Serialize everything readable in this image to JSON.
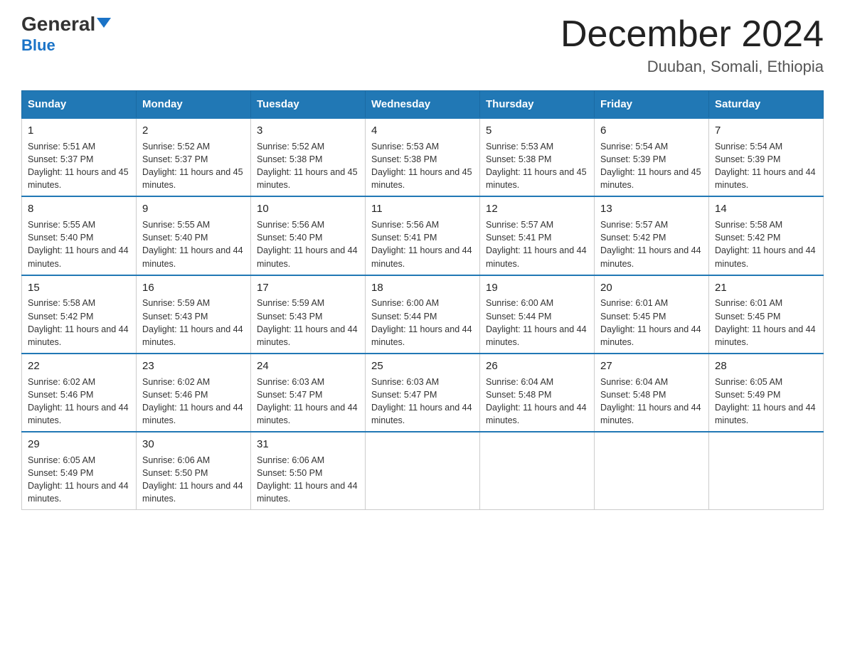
{
  "header": {
    "logo_general": "General",
    "logo_blue": "Blue",
    "title": "December 2024",
    "subtitle": "Duuban, Somali, Ethiopia"
  },
  "weekdays": [
    "Sunday",
    "Monday",
    "Tuesday",
    "Wednesday",
    "Thursday",
    "Friday",
    "Saturday"
  ],
  "weeks": [
    [
      {
        "day": "1",
        "sunrise": "5:51 AM",
        "sunset": "5:37 PM",
        "daylight": "11 hours and 45 minutes."
      },
      {
        "day": "2",
        "sunrise": "5:52 AM",
        "sunset": "5:37 PM",
        "daylight": "11 hours and 45 minutes."
      },
      {
        "day": "3",
        "sunrise": "5:52 AM",
        "sunset": "5:38 PM",
        "daylight": "11 hours and 45 minutes."
      },
      {
        "day": "4",
        "sunrise": "5:53 AM",
        "sunset": "5:38 PM",
        "daylight": "11 hours and 45 minutes."
      },
      {
        "day": "5",
        "sunrise": "5:53 AM",
        "sunset": "5:38 PM",
        "daylight": "11 hours and 45 minutes."
      },
      {
        "day": "6",
        "sunrise": "5:54 AM",
        "sunset": "5:39 PM",
        "daylight": "11 hours and 45 minutes."
      },
      {
        "day": "7",
        "sunrise": "5:54 AM",
        "sunset": "5:39 PM",
        "daylight": "11 hours and 44 minutes."
      }
    ],
    [
      {
        "day": "8",
        "sunrise": "5:55 AM",
        "sunset": "5:40 PM",
        "daylight": "11 hours and 44 minutes."
      },
      {
        "day": "9",
        "sunrise": "5:55 AM",
        "sunset": "5:40 PM",
        "daylight": "11 hours and 44 minutes."
      },
      {
        "day": "10",
        "sunrise": "5:56 AM",
        "sunset": "5:40 PM",
        "daylight": "11 hours and 44 minutes."
      },
      {
        "day": "11",
        "sunrise": "5:56 AM",
        "sunset": "5:41 PM",
        "daylight": "11 hours and 44 minutes."
      },
      {
        "day": "12",
        "sunrise": "5:57 AM",
        "sunset": "5:41 PM",
        "daylight": "11 hours and 44 minutes."
      },
      {
        "day": "13",
        "sunrise": "5:57 AM",
        "sunset": "5:42 PM",
        "daylight": "11 hours and 44 minutes."
      },
      {
        "day": "14",
        "sunrise": "5:58 AM",
        "sunset": "5:42 PM",
        "daylight": "11 hours and 44 minutes."
      }
    ],
    [
      {
        "day": "15",
        "sunrise": "5:58 AM",
        "sunset": "5:42 PM",
        "daylight": "11 hours and 44 minutes."
      },
      {
        "day": "16",
        "sunrise": "5:59 AM",
        "sunset": "5:43 PM",
        "daylight": "11 hours and 44 minutes."
      },
      {
        "day": "17",
        "sunrise": "5:59 AM",
        "sunset": "5:43 PM",
        "daylight": "11 hours and 44 minutes."
      },
      {
        "day": "18",
        "sunrise": "6:00 AM",
        "sunset": "5:44 PM",
        "daylight": "11 hours and 44 minutes."
      },
      {
        "day": "19",
        "sunrise": "6:00 AM",
        "sunset": "5:44 PM",
        "daylight": "11 hours and 44 minutes."
      },
      {
        "day": "20",
        "sunrise": "6:01 AM",
        "sunset": "5:45 PM",
        "daylight": "11 hours and 44 minutes."
      },
      {
        "day": "21",
        "sunrise": "6:01 AM",
        "sunset": "5:45 PM",
        "daylight": "11 hours and 44 minutes."
      }
    ],
    [
      {
        "day": "22",
        "sunrise": "6:02 AM",
        "sunset": "5:46 PM",
        "daylight": "11 hours and 44 minutes."
      },
      {
        "day": "23",
        "sunrise": "6:02 AM",
        "sunset": "5:46 PM",
        "daylight": "11 hours and 44 minutes."
      },
      {
        "day": "24",
        "sunrise": "6:03 AM",
        "sunset": "5:47 PM",
        "daylight": "11 hours and 44 minutes."
      },
      {
        "day": "25",
        "sunrise": "6:03 AM",
        "sunset": "5:47 PM",
        "daylight": "11 hours and 44 minutes."
      },
      {
        "day": "26",
        "sunrise": "6:04 AM",
        "sunset": "5:48 PM",
        "daylight": "11 hours and 44 minutes."
      },
      {
        "day": "27",
        "sunrise": "6:04 AM",
        "sunset": "5:48 PM",
        "daylight": "11 hours and 44 minutes."
      },
      {
        "day": "28",
        "sunrise": "6:05 AM",
        "sunset": "5:49 PM",
        "daylight": "11 hours and 44 minutes."
      }
    ],
    [
      {
        "day": "29",
        "sunrise": "6:05 AM",
        "sunset": "5:49 PM",
        "daylight": "11 hours and 44 minutes."
      },
      {
        "day": "30",
        "sunrise": "6:06 AM",
        "sunset": "5:50 PM",
        "daylight": "11 hours and 44 minutes."
      },
      {
        "day": "31",
        "sunrise": "6:06 AM",
        "sunset": "5:50 PM",
        "daylight": "11 hours and 44 minutes."
      },
      null,
      null,
      null,
      null
    ]
  ]
}
